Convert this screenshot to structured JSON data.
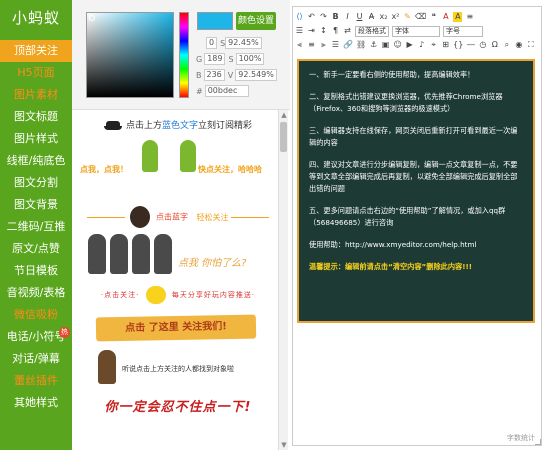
{
  "sidebar": {
    "logo": "小蚂蚁",
    "items": [
      {
        "label": "顶部关注"
      },
      {
        "label": "H5页面"
      },
      {
        "label": "图片素材"
      },
      {
        "label": "图文标题"
      },
      {
        "label": "图片样式"
      },
      {
        "label": "线框/纯底色"
      },
      {
        "label": "图文分割"
      },
      {
        "label": "图文背景"
      },
      {
        "label": "二维码/互推"
      },
      {
        "label": "原文/点赞"
      },
      {
        "label": "节日模板"
      },
      {
        "label": "音视频/表格"
      },
      {
        "label": "微信吸粉"
      },
      {
        "label": "电话/小符号",
        "badge": "热"
      },
      {
        "label": "对话/弹幕"
      },
      {
        "label": "蕾丝插件"
      },
      {
        "label": "其她样式"
      }
    ]
  },
  "picker": {
    "set_button": "颜色设置",
    "h": "0",
    "s": "92.45%",
    "g": "189",
    "s2": "100%",
    "b": "236",
    "v": "92.549%",
    "hex": "00bdec",
    "label_g": "G",
    "label_b": "B",
    "label_s": "S",
    "label_v": "V",
    "label_hash": "#",
    "swatch_color": "#1eb6e8"
  },
  "templates": {
    "t1_prefix": "点击上方",
    "t1_blue": "蓝色文字",
    "t1_suffix": "立刻订阅精彩",
    "t2_left": "点我，点我！",
    "t2_right": "快点关注，哈哈哈",
    "t3_left": "点击蓝字",
    "t3_right": "轻松关注",
    "t4_text": "点我 你怕了么?",
    "t5_left": "·点击关注·",
    "t5_right": "每天分享好玩内容推送·",
    "t6_text": "点击 了这里 关注我们!",
    "t7_text": "听说点击上方关注的人都找到对象啦",
    "t8_text": "你一定会忍不住点一下!"
  },
  "editor": {
    "toolbar": {
      "paragraph_format": "段落格式",
      "font_family": "字体",
      "font_size": "字号"
    },
    "content": [
      "一、新手一定要看右侧的使用帮助，提高编辑效率！",
      "二、复制格式出错建议更换浏览器，优先推荐Chrome浏览器（Firefox、360和搜狗等浏览器的极速模式）",
      "三、编辑器支持在线保存，网页关闭后重新打开可看到最近一次编辑的内容",
      "四、建议对文章进行分步编辑复制，编辑一点文章复制一点，不要等到文章全部编辑完成后再复制，以避免全部编辑完成后复制全部出错的问题",
      "五、更多问题请点击右边的“使用帮助”了解情况，或加入qq群（568496685）进行咨询",
      "使用帮助：http://www.xmyeditor.com/help.html"
    ],
    "tip": "温馨提示：编辑前请点击“清空内容”删除此内容!!!",
    "word_count": "字数统计"
  }
}
